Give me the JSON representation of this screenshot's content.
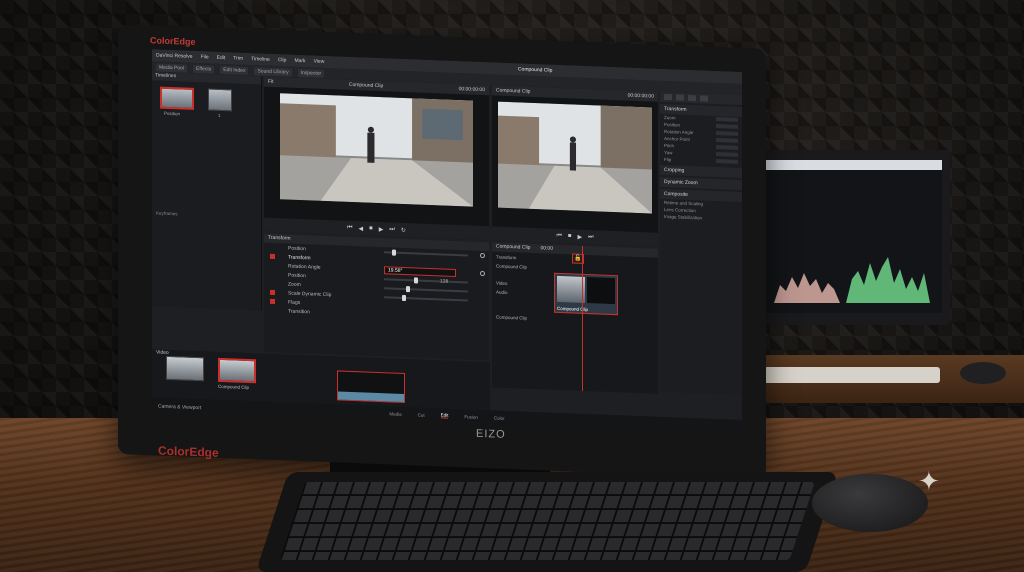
{
  "scene": {
    "monitor_brand_top": "ColorEdge",
    "monitor_brand_bottom": "ColorEdge",
    "monitor_logo": "EIZO"
  },
  "app": {
    "project_title": "Compound Clip",
    "menubar": [
      "DaVinci Resolve",
      "File",
      "Edit",
      "Trim",
      "Timeline",
      "Clip",
      "Mark",
      "View"
    ],
    "toolbar": [
      "Media Pool",
      "Effects",
      "Edit Index",
      "Sound Library",
      "Inspector"
    ],
    "media_pool": {
      "header": "Timelines",
      "clips": [
        {
          "label": "Position"
        },
        {
          "label": "1"
        }
      ],
      "lower_label": "Keyframes"
    },
    "source_viewer": {
      "title": "Compound Clip",
      "zoom": "Fit",
      "timecode": "00:00:00:00"
    },
    "timeline_viewer": {
      "title": "Compound Clip",
      "timecode": "00:00:00:00"
    },
    "inspector": {
      "sections": [
        "Transform",
        "Cropping",
        "Dynamic Zoom",
        "Composite"
      ],
      "rows": [
        "Zoom",
        "Position",
        "Rotation Angle",
        "Anchor Point",
        "Pitch",
        "Yaw",
        "Flip"
      ],
      "lower_sections": [
        "Retime and Scaling",
        "Lens Correction",
        "Image Stabilization"
      ]
    },
    "keyframe_panel": {
      "title": "Transform",
      "rows": [
        {
          "label": "Position",
          "type": "row"
        },
        {
          "label": "Transform",
          "type": "section"
        },
        {
          "label": "Rotation Angle",
          "type": "value",
          "value": "19.58°"
        },
        {
          "label": "Position",
          "type": "number",
          "value": "128"
        },
        {
          "label": "Zoom",
          "type": "row"
        },
        {
          "label": "Scale Dynamic Clip",
          "type": "row"
        },
        {
          "label": "Flags",
          "type": "row"
        },
        {
          "label": "Transition",
          "type": "row"
        }
      ]
    },
    "timeline": {
      "tracks": [
        "Transform",
        "Compound Clip",
        "Video",
        "Audio",
        "Compound Clip"
      ],
      "clip_label": "Compound Clip",
      "header_items": [
        "Compound Clip",
        "00:00"
      ]
    },
    "bottom_timeline": {
      "header": "Video",
      "clips": [
        {
          "label": "Position"
        },
        {
          "label": "Compound Clip"
        }
      ],
      "status": "Camera & Viewport"
    },
    "pages": [
      {
        "label": "Media",
        "active": false
      },
      {
        "label": "Cut",
        "active": false
      },
      {
        "label": "Edit",
        "active": true
      },
      {
        "label": "Fusion",
        "active": false
      },
      {
        "label": "Color",
        "active": false
      }
    ]
  },
  "colors": {
    "accent": "#c9302c",
    "panel": "#1e1f22",
    "desk": "#5a3720"
  }
}
